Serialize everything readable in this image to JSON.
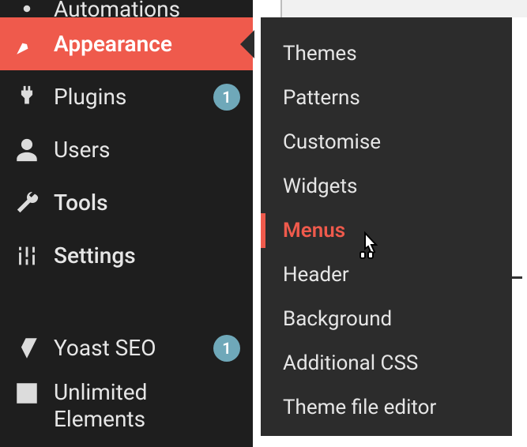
{
  "sidebar": {
    "top_truncated_label": "Automations",
    "items": [
      {
        "label": "Appearance"
      },
      {
        "label": "Plugins",
        "badge": "1"
      },
      {
        "label": "Users"
      },
      {
        "label": "Tools"
      },
      {
        "label": "Settings"
      },
      {
        "label": "Yoast SEO",
        "badge": "1"
      },
      {
        "label": "Unlimited Elements"
      }
    ]
  },
  "submenu": {
    "items": [
      "Themes",
      "Patterns",
      "Customise",
      "Widgets",
      "Menus",
      "Header",
      "Background",
      "Additional CSS",
      "Theme file editor"
    ],
    "active_index": 4
  },
  "colors": {
    "accent": "#ef5a4c",
    "badge": "#6fa8b9",
    "sidebar_bg": "#1e1e1e",
    "submenu_bg": "#2c2c2c"
  }
}
